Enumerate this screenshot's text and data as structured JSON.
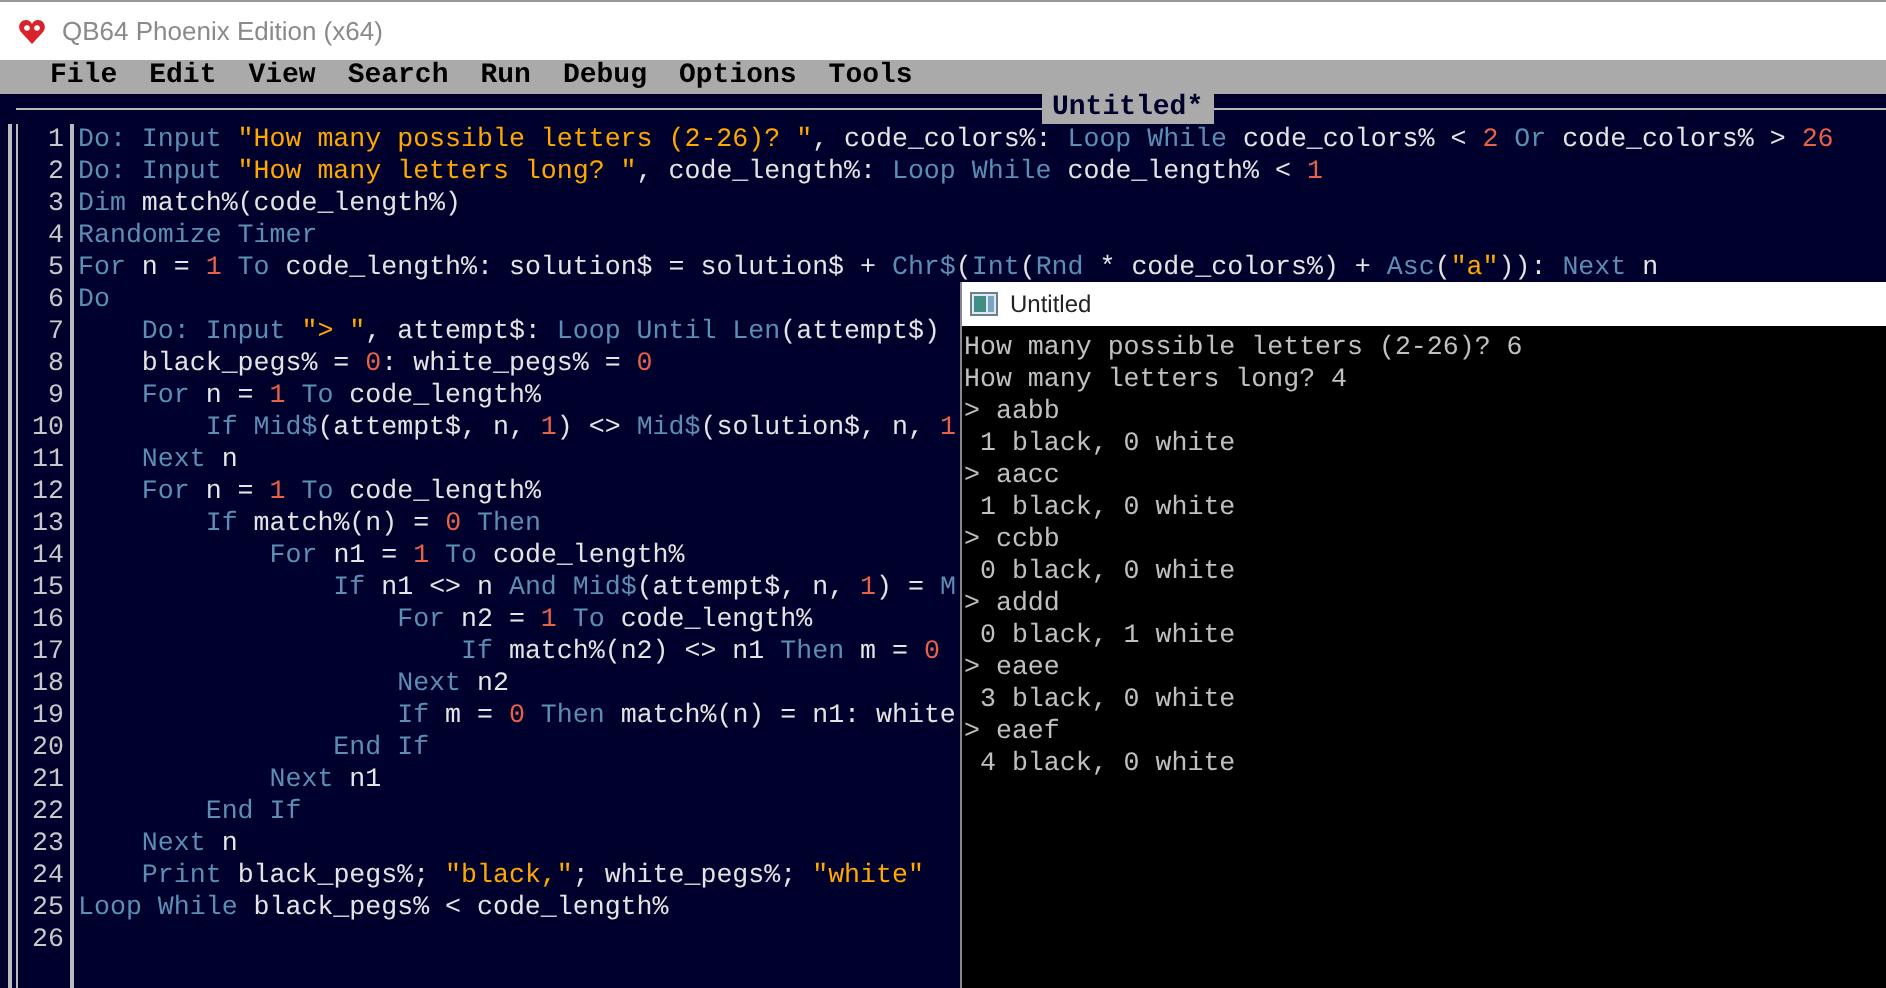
{
  "window": {
    "title": "QB64 Phoenix Edition (x64)"
  },
  "menu": [
    "File",
    "Edit",
    "View",
    "Search",
    "Run",
    "Debug",
    "Options",
    "Tools"
  ],
  "editor": {
    "tab_title": "Untitled*",
    "lines": [
      {
        "number": "1",
        "tokens": [
          {
            "kind": "kw",
            "text": "Do: Input "
          },
          {
            "kind": "str",
            "text": "\"How many possible letters (2-26)? \""
          },
          {
            "kind": "id",
            "text": ", code_colors%: "
          },
          {
            "kind": "kw",
            "text": "Loop While "
          },
          {
            "kind": "id",
            "text": "code_colors% < "
          },
          {
            "kind": "num",
            "text": "2"
          },
          {
            "kind": "kw",
            "text": " Or "
          },
          {
            "kind": "id",
            "text": "code_colors% > "
          },
          {
            "kind": "num",
            "text": "26"
          }
        ]
      },
      {
        "number": "2",
        "tokens": [
          {
            "kind": "kw",
            "text": "Do: Input "
          },
          {
            "kind": "str",
            "text": "\"How many letters long? \""
          },
          {
            "kind": "id",
            "text": ", code_length%: "
          },
          {
            "kind": "kw",
            "text": "Loop While "
          },
          {
            "kind": "id",
            "text": "code_length% < "
          },
          {
            "kind": "num",
            "text": "1"
          }
        ]
      },
      {
        "number": "3",
        "tokens": [
          {
            "kind": "kw",
            "text": "Dim "
          },
          {
            "kind": "id",
            "text": "match%(code_length%)"
          }
        ]
      },
      {
        "number": "4",
        "tokens": [
          {
            "kind": "kw",
            "text": "Randomize Timer"
          }
        ]
      },
      {
        "number": "5",
        "tokens": [
          {
            "kind": "kw",
            "text": "For "
          },
          {
            "kind": "id",
            "text": "n = "
          },
          {
            "kind": "num",
            "text": "1"
          },
          {
            "kind": "kw",
            "text": " To "
          },
          {
            "kind": "id",
            "text": "code_length%: solution$ = solution$ + "
          },
          {
            "kind": "kw",
            "text": "Chr$"
          },
          {
            "kind": "id",
            "text": "("
          },
          {
            "kind": "kw",
            "text": "Int"
          },
          {
            "kind": "id",
            "text": "("
          },
          {
            "kind": "kw",
            "text": "Rnd"
          },
          {
            "kind": "id",
            "text": " * code_colors%) + "
          },
          {
            "kind": "kw",
            "text": "Asc"
          },
          {
            "kind": "id",
            "text": "("
          },
          {
            "kind": "str",
            "text": "\"a\""
          },
          {
            "kind": "id",
            "text": ")): "
          },
          {
            "kind": "kw",
            "text": "Next "
          },
          {
            "kind": "id",
            "text": "n"
          }
        ]
      },
      {
        "number": "6",
        "tokens": [
          {
            "kind": "kw",
            "text": "Do"
          }
        ]
      },
      {
        "number": "7",
        "tokens": [
          {
            "kind": "kw",
            "text": "    Do: Input "
          },
          {
            "kind": "str",
            "text": "\"> \""
          },
          {
            "kind": "id",
            "text": ", attempt$: "
          },
          {
            "kind": "kw",
            "text": "Loop Until Len"
          },
          {
            "kind": "id",
            "text": "(attempt$)"
          }
        ]
      },
      {
        "number": "8",
        "tokens": [
          {
            "kind": "id",
            "text": "    black_pegs% = "
          },
          {
            "kind": "num",
            "text": "0"
          },
          {
            "kind": "id",
            "text": ": white_pegs% = "
          },
          {
            "kind": "num",
            "text": "0"
          }
        ]
      },
      {
        "number": "9",
        "tokens": [
          {
            "kind": "kw",
            "text": "    For "
          },
          {
            "kind": "id",
            "text": "n = "
          },
          {
            "kind": "num",
            "text": "1"
          },
          {
            "kind": "kw",
            "text": " To "
          },
          {
            "kind": "id",
            "text": "code_length%"
          }
        ]
      },
      {
        "number": "10",
        "tokens": [
          {
            "kind": "kw",
            "text": "        If Mid$"
          },
          {
            "kind": "id",
            "text": "(attempt$, n, "
          },
          {
            "kind": "num",
            "text": "1"
          },
          {
            "kind": "id",
            "text": ") <> "
          },
          {
            "kind": "kw",
            "text": "Mid$"
          },
          {
            "kind": "id",
            "text": "(solution$, n, "
          },
          {
            "kind": "num",
            "text": "1"
          }
        ]
      },
      {
        "number": "11",
        "tokens": [
          {
            "kind": "kw",
            "text": "    Next "
          },
          {
            "kind": "id",
            "text": "n"
          }
        ]
      },
      {
        "number": "12",
        "tokens": [
          {
            "kind": "kw",
            "text": "    For "
          },
          {
            "kind": "id",
            "text": "n = "
          },
          {
            "kind": "num",
            "text": "1"
          },
          {
            "kind": "kw",
            "text": " To "
          },
          {
            "kind": "id",
            "text": "code_length%"
          }
        ]
      },
      {
        "number": "13",
        "tokens": [
          {
            "kind": "kw",
            "text": "        If "
          },
          {
            "kind": "id",
            "text": "match%(n) = "
          },
          {
            "kind": "num",
            "text": "0"
          },
          {
            "kind": "kw",
            "text": " Then"
          }
        ]
      },
      {
        "number": "14",
        "tokens": [
          {
            "kind": "kw",
            "text": "            For "
          },
          {
            "kind": "id",
            "text": "n1 = "
          },
          {
            "kind": "num",
            "text": "1"
          },
          {
            "kind": "kw",
            "text": " To "
          },
          {
            "kind": "id",
            "text": "code_length%"
          }
        ]
      },
      {
        "number": "15",
        "tokens": [
          {
            "kind": "kw",
            "text": "                If "
          },
          {
            "kind": "id",
            "text": "n1 <> n "
          },
          {
            "kind": "kw",
            "text": "And Mid$"
          },
          {
            "kind": "id",
            "text": "(attempt$, n, "
          },
          {
            "kind": "num",
            "text": "1"
          },
          {
            "kind": "id",
            "text": ") = "
          },
          {
            "kind": "kw",
            "text": "M"
          }
        ]
      },
      {
        "number": "16",
        "tokens": [
          {
            "kind": "kw",
            "text": "                    For "
          },
          {
            "kind": "id",
            "text": "n2 = "
          },
          {
            "kind": "num",
            "text": "1"
          },
          {
            "kind": "kw",
            "text": " To "
          },
          {
            "kind": "id",
            "text": "code_length%"
          }
        ]
      },
      {
        "number": "17",
        "tokens": [
          {
            "kind": "kw",
            "text": "                        If "
          },
          {
            "kind": "id",
            "text": "match%(n2) <> n1 "
          },
          {
            "kind": "kw",
            "text": "Then "
          },
          {
            "kind": "id",
            "text": "m = "
          },
          {
            "kind": "num",
            "text": "0"
          }
        ]
      },
      {
        "number": "18",
        "tokens": [
          {
            "kind": "kw",
            "text": "                    Next "
          },
          {
            "kind": "id",
            "text": "n2"
          }
        ]
      },
      {
        "number": "19",
        "tokens": [
          {
            "kind": "kw",
            "text": "                    If "
          },
          {
            "kind": "id",
            "text": "m = "
          },
          {
            "kind": "num",
            "text": "0"
          },
          {
            "kind": "kw",
            "text": " Then "
          },
          {
            "kind": "id",
            "text": "match%(n) = n1: white"
          }
        ]
      },
      {
        "number": "20",
        "tokens": [
          {
            "kind": "kw",
            "text": "                End If"
          }
        ]
      },
      {
        "number": "21",
        "tokens": [
          {
            "kind": "kw",
            "text": "            Next "
          },
          {
            "kind": "id",
            "text": "n1"
          }
        ]
      },
      {
        "number": "22",
        "tokens": [
          {
            "kind": "kw",
            "text": "        End If"
          }
        ]
      },
      {
        "number": "23",
        "tokens": [
          {
            "kind": "kw",
            "text": "    Next "
          },
          {
            "kind": "id",
            "text": "n"
          }
        ]
      },
      {
        "number": "24",
        "tokens": [
          {
            "kind": "kw",
            "text": "    Print "
          },
          {
            "kind": "id",
            "text": "black_pegs%; "
          },
          {
            "kind": "str",
            "text": "\"black,\""
          },
          {
            "kind": "id",
            "text": "; white_pegs%; "
          },
          {
            "kind": "str",
            "text": "\"white\""
          }
        ]
      },
      {
        "number": "25",
        "tokens": [
          {
            "kind": "kw",
            "text": "Loop While "
          },
          {
            "kind": "id",
            "text": "black_pegs% < code_length%"
          }
        ]
      },
      {
        "number": "26"
      }
    ]
  },
  "console": {
    "title": "Untitled",
    "lines": [
      "How many possible letters (2-26)? 6",
      "How many letters long? 4",
      "> aabb",
      " 1 black, 0 white",
      "> aacc",
      " 1 black, 0 white",
      "> ccbb",
      " 0 black, 0 white",
      "> addd",
      " 0 black, 1 white",
      "> eaee",
      " 3 black, 0 white",
      "> eaef",
      " 4 black, 0 white"
    ]
  }
}
